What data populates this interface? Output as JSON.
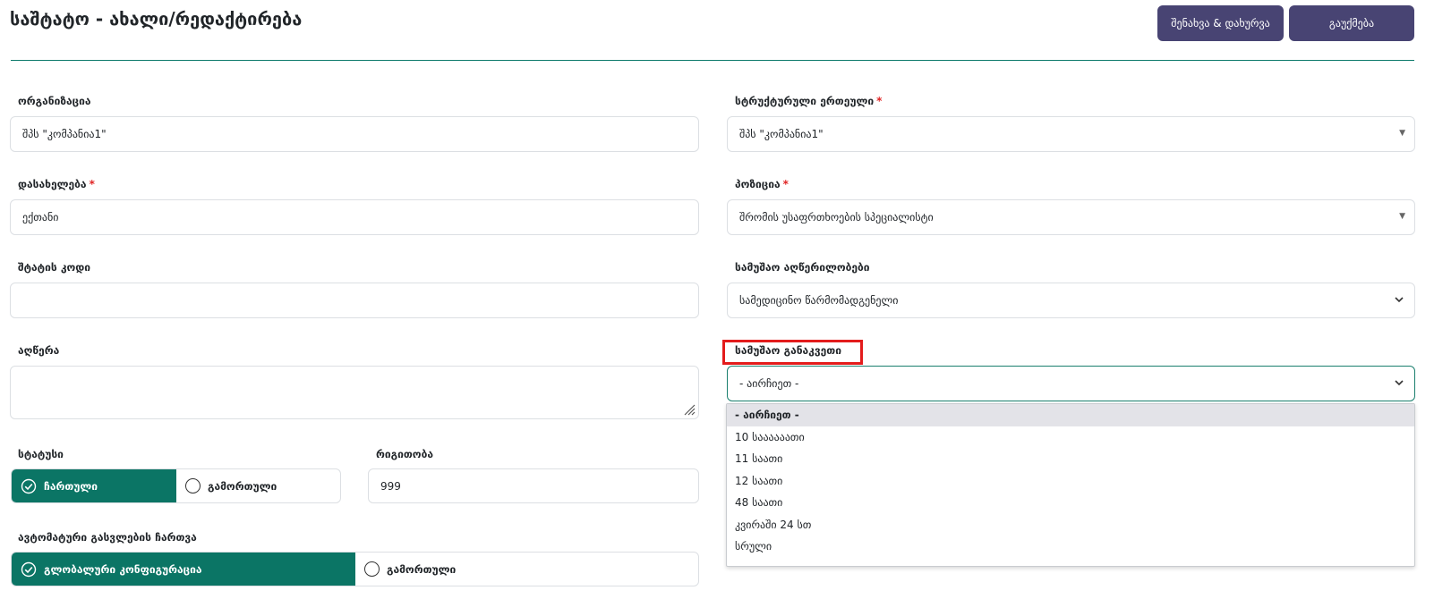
{
  "header": {
    "title": "საშტატო - ახალი/რედაქტირება",
    "save_label": "შენახვა & დახურვა",
    "cancel_label": "გაუქმება"
  },
  "form": {
    "organization": {
      "label": "ორგანიზაცია",
      "value": "შპს \"კომპანია1\""
    },
    "structural_unit": {
      "label": "სტრუქტურული ერთეული",
      "required": "*",
      "value": "შპს \"კომპანია1\""
    },
    "name": {
      "label": "დასახელება",
      "required": "*",
      "value": "ექთანი"
    },
    "position": {
      "label": "პოზიცია",
      "required": "*",
      "value": "შრომის უსაფრთხოების სპეციალისტი"
    },
    "staff_code": {
      "label": "შტატის კოდი",
      "value": ""
    },
    "job_descriptions": {
      "label": "სამუშაო აღწერილობები",
      "value": "სამედიცინო წარმომადგენელი"
    },
    "description": {
      "label": "აღწერა",
      "value": ""
    },
    "work_schedule": {
      "label": "სამუშაო განაკვეთი",
      "value": "- აირჩიეთ -",
      "options": [
        "- აირჩიეთ -",
        "10 საააააათი",
        "11 საათი",
        "12 საათი",
        "48 საათი",
        "კვირაში 24 სთ",
        "სრული"
      ]
    },
    "status": {
      "label": "სტატუსი",
      "on_label": "ჩართული",
      "off_label": "გამორთული"
    },
    "order": {
      "label": "რიგითობა",
      "value": "999"
    },
    "auto_logout": {
      "label": "ავტომატური გასვლების ჩართვა",
      "on_label": "გლობალური კონფიგურაცია",
      "off_label": "გამორთული"
    }
  },
  "colors": {
    "primary_button": "#484473",
    "accent_green": "#0b7565",
    "highlight_red": "#e31c1c",
    "required_red": "#e02424"
  },
  "icons": {
    "check": "check-circle-icon",
    "radio": "radio-empty-icon",
    "chevron": "chevron-down-icon",
    "triangle": "caret-down-icon",
    "resize": "resize-handle-icon"
  }
}
